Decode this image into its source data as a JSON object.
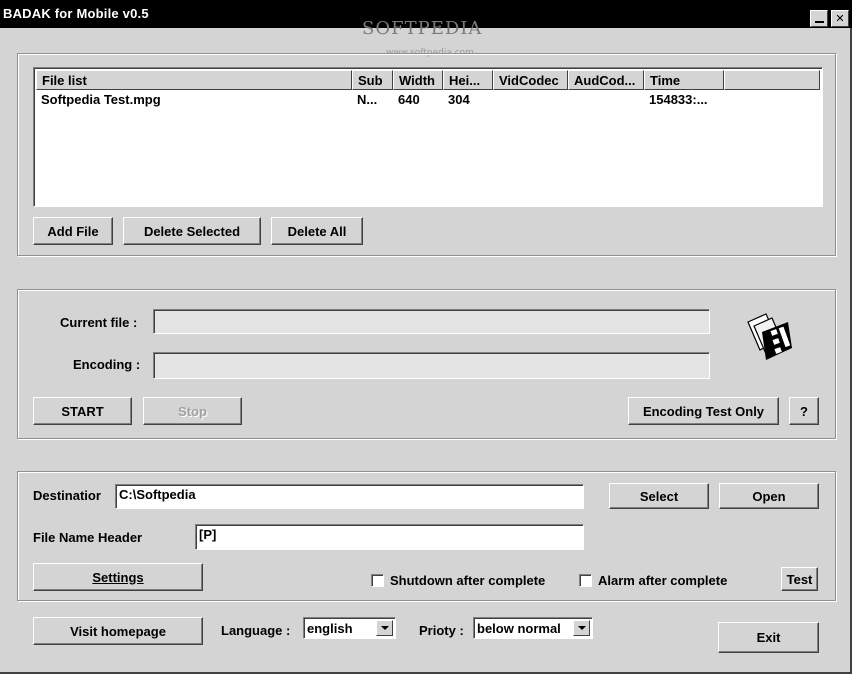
{
  "window": {
    "title": "BADAK for Mobile v0.5"
  },
  "watermark": {
    "text": "SOFTPEDIA",
    "sub": "www.softpedia.com"
  },
  "file_list": {
    "columns": [
      "File list",
      "Sub",
      "Width",
      "Hei...",
      "VidCodec",
      "AudCod...",
      "Time"
    ],
    "rows": [
      [
        "Softpedia Test.mpg",
        "N...",
        "640",
        "304",
        "",
        "",
        "154833:..."
      ]
    ]
  },
  "file_buttons": {
    "add": "Add File",
    "delete_selected": "Delete Selected",
    "delete_all": "Delete All"
  },
  "progress": {
    "current_file_label": "Current file :",
    "current_file_value": "",
    "encoding_label": "Encoding :",
    "encoding_value": "",
    "start": "START",
    "stop": "Stop",
    "encoding_test": "Encoding Test Only",
    "help": "?"
  },
  "output": {
    "destination_label": "Destinatior",
    "destination_value": "C:\\Softpedia",
    "select": "Select",
    "open": "Open",
    "header_label": "File Name Header",
    "header_value": "[P]",
    "settings": "Settings",
    "shutdown_label": "Shutdown after complete",
    "alarm_label": "Alarm after complete",
    "test": "Test"
  },
  "footer": {
    "homepage": "Visit homepage",
    "language_label": "Language :",
    "language_value": "english",
    "priority_label": "Prioty :",
    "priority_value": "below normal",
    "exit": "Exit"
  }
}
